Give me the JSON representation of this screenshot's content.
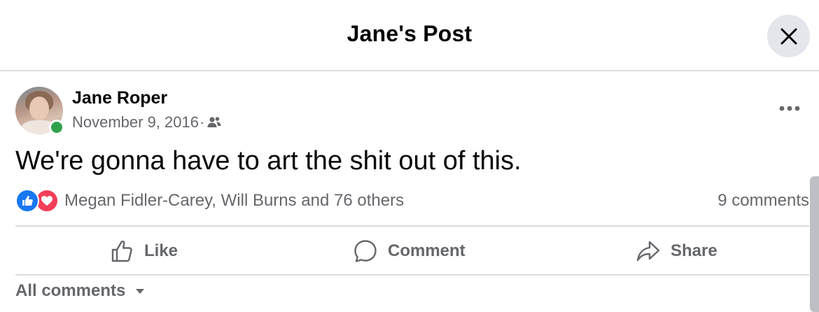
{
  "header": {
    "title": "Jane's Post"
  },
  "post": {
    "author": "Jane Roper",
    "date": "November 9, 2016",
    "separator": "·",
    "audience_icon": "friends-icon",
    "text": "We're gonna have to art the shit out of this.",
    "reactions": {
      "icons": [
        "like-reaction-icon",
        "love-reaction-icon"
      ],
      "names": "Megan Fidler-Carey, Will Burns and 76 others"
    },
    "comments_count": "9 comments"
  },
  "actions": {
    "like": "Like",
    "comment": "Comment",
    "share": "Share"
  },
  "comments_filter": {
    "label": "All comments"
  },
  "colors": {
    "like_blue": "#1877f2",
    "love_red": "#f33e58",
    "online_green": "#31a24c",
    "secondary_text": "#65676b",
    "divider": "#dadde1"
  }
}
